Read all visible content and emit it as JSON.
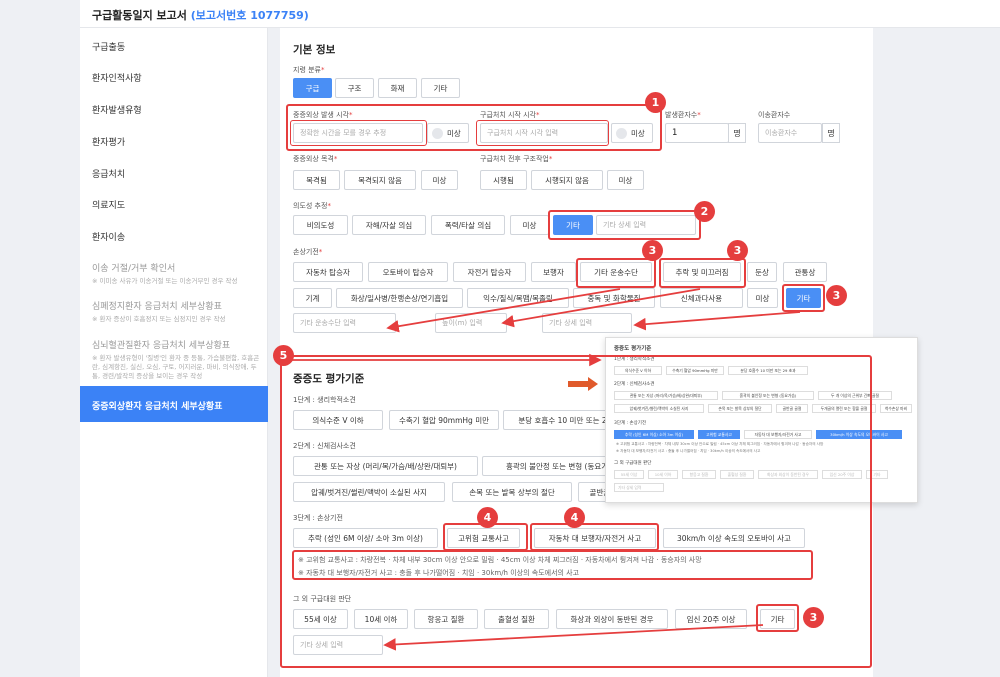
{
  "header": {
    "title": "구급활동일지 보고서",
    "report_no": "(보고서번호 1077759)"
  },
  "sidebar": {
    "items": [
      {
        "label": "구급출동"
      },
      {
        "label": "환자인적사항"
      },
      {
        "label": "환자발생유형"
      },
      {
        "label": "환자평가"
      },
      {
        "label": "응급처치"
      },
      {
        "label": "의료지도"
      },
      {
        "label": "환자이송"
      },
      {
        "label": "이송 거절/거부 확인서",
        "sub": "※ 이미송 사유가 이송거절 또는 이송거부인 경우 작성"
      },
      {
        "label": "심폐정지환자 응급처치 세부상황표",
        "sub": "※ 환자 증상이 호흡정지 또는 심정지인 경우 작성"
      },
      {
        "label": "심뇌혈관질환자 응급처치 세부상황표",
        "sub": "※ 환자 발생유형이 '질병'인 환자 중 등통, 가슴불편함, 호흡곤란, 심계항진, 실신, 오심, 구토, 어지러운, 마비, 의식장애, 두통, 경련/발작의 증상을 보이는 경우 작성"
      },
      {
        "label": "중증외상환자 응급처치 세부상황표"
      }
    ]
  },
  "basic": {
    "title": "기본 정보",
    "incident_type_label": "지령 분류",
    "incident_types": [
      "구급",
      "구조",
      "화재",
      "기타"
    ],
    "trauma_time_label": "중증외상 발생 시각",
    "trauma_time_placeholder": "정확한 시간을 모를 경우 추정",
    "unknown_label": "미상",
    "first_aid_time_label": "구급처치 시작 시각",
    "first_aid_time_placeholder": "구급처치 시작 시각 입력",
    "patients_label": "발생환자수",
    "patients_value": "1",
    "patients_unit": "명",
    "transported_label": "이송환자수",
    "transported_placeholder": "이송환자수",
    "transported_unit": "명",
    "witnessed_label": "중증외상 목격",
    "witnessed_options": [
      "목격됨",
      "목격되지 않음",
      "미상"
    ],
    "structural_label": "구급처치 전후 구조작업",
    "structural_options": [
      "시행됨",
      "시행되지 않음",
      "미상"
    ],
    "intent_label": "의도성 추정",
    "intent_options": [
      "비의도성",
      "자해/자살 의심",
      "폭력/타살 의심",
      "미상",
      "기타"
    ],
    "intent_other_placeholder": "기타 상세 입력",
    "mechanism_label": "손상기전",
    "mechanism_row1": [
      "자동차 탑승자",
      "오토바이 탑승자",
      "자전거 탑승자",
      "보행자",
      "기타 운송수단",
      "추락 및 미끄러짐",
      "둔상",
      "관통상"
    ],
    "mechanism_row2": [
      "기계",
      "화상/일사병/한랭손상/연기흡입",
      "익수/질식/목맴/목졸림",
      "중독 및 화학물질",
      "신체과다사용",
      "미상",
      "기타"
    ],
    "transport_other_placeholder": "기타 운송수단 입력",
    "height_placeholder": "높이(m) 입력",
    "mechanism_other_placeholder": "기타 상세 입력"
  },
  "severity": {
    "title": "중증도 평가기준",
    "step1_label": "1단계 : 생리학적소견",
    "step1_options": [
      "의식수준 V 이하",
      "수축기 혈압 90mmHg 미만",
      "분당 호흡수 10 미만 또는 29 초과"
    ],
    "step2_label": "2단계 : 신체검사소견",
    "step2_row1": [
      "관통 또는 자상 (머리/목/가슴/배/상완/대퇴부)",
      "흉곽의 불안정 또는 변형 (동요가슴)",
      "두 개 이상의 근위부 긴뼈 골절"
    ],
    "step2_row2": [
      "압궤/벗겨진/썰린/맥박이 소실된 사지",
      "손목 또는 발목 상부의 절단",
      "골반골 골절",
      "두개골의 열린 또는 함몰 골절",
      "척수손상 마비"
    ],
    "step3_label": "3단계 : 손상기전",
    "step3_options": [
      "추락 (성인 6M 이상/ 소아 3m 이상)",
      "고위험 교통사고",
      "자동차 대 보행자/자전거 사고",
      "30km/h 이상 속도의 오토바이 사고"
    ],
    "note1": "※ 고위험 교통사고 : 차량전복 · 차체 내부 30cm 이상 안으로 밀림 · 45cm 이상 차체 찌그러짐 · 자동차에서 튕겨져 나감 · 동승자의 사망",
    "note2": "※ 자동차 대 보행자/자전거 사고 : 충돌 후 나가떨어짐 · 치임 · 30km/h 이상의 속도에서의 사고",
    "other_label": "그 외 구급대원 판단",
    "other_options": [
      "55세 이상",
      "10세 이하",
      "항응고 질환",
      "출혈성 질환",
      "화상과 외상이 동반된 경우",
      "임신 20주 이상",
      "기타"
    ],
    "other_placeholder": "기타 상세 입력"
  },
  "thumb": {
    "title": "중증도 평가기준",
    "step1": "1단계 : 생리학적소견",
    "step2": "2단계 : 신체검사소견",
    "step3": "3단계 : 손상기전",
    "other": "그 외 구급대원 판단"
  },
  "badges": [
    "1",
    "2",
    "3",
    "3",
    "3",
    "3",
    "4",
    "4",
    "5"
  ],
  "colors": {
    "accent": "#4a8ff5",
    "highlight": "#e53e3e"
  }
}
